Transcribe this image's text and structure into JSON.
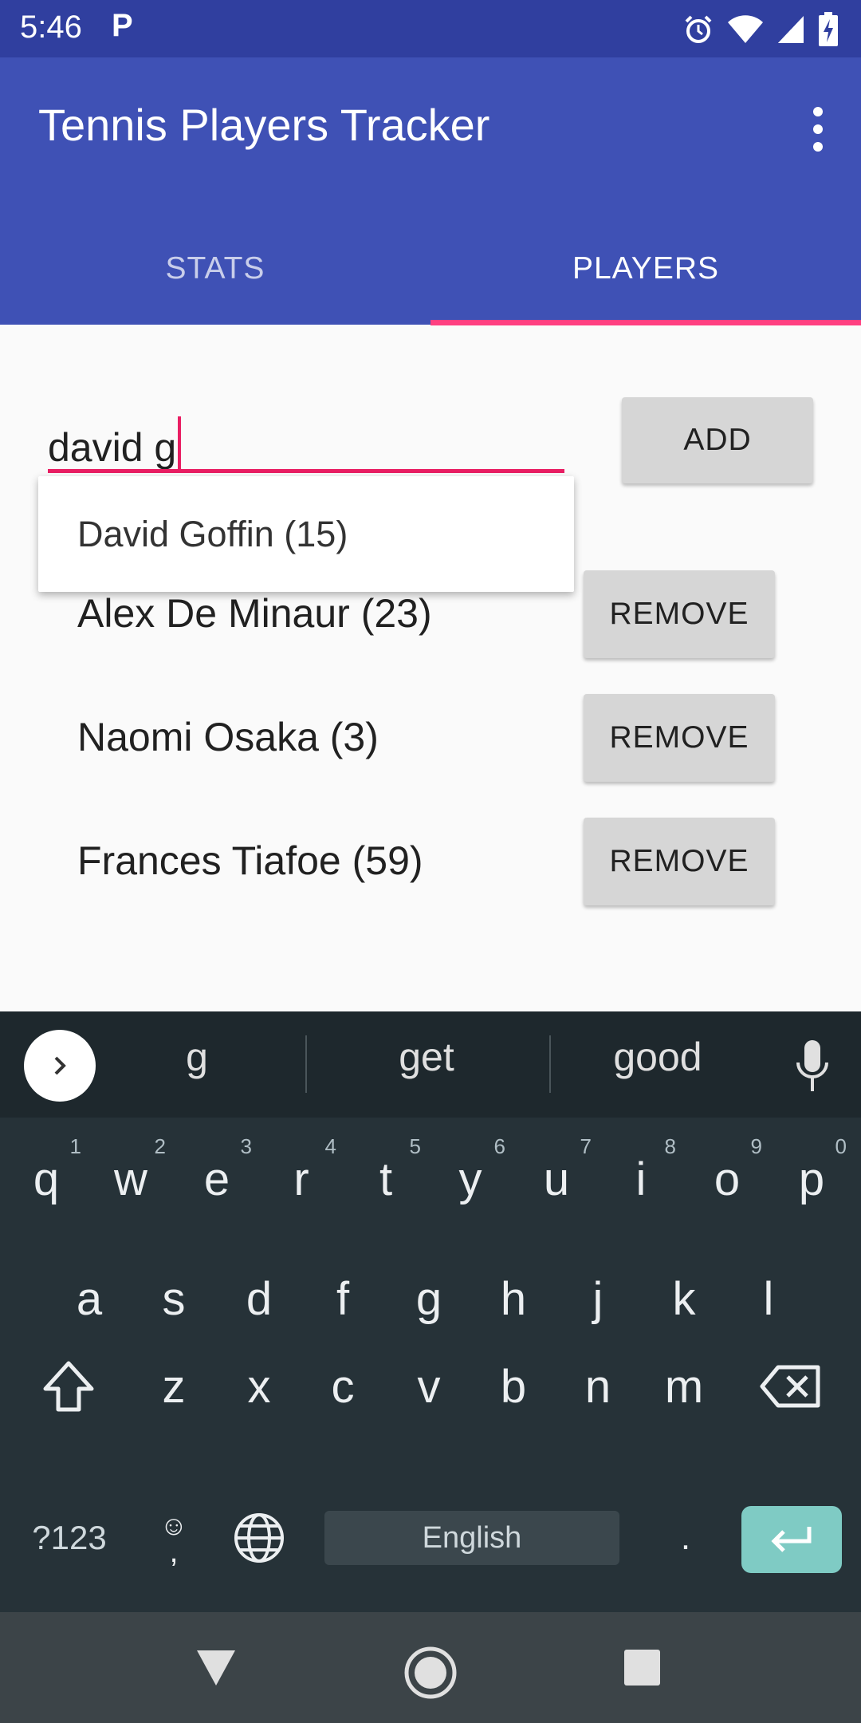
{
  "status_bar": {
    "time": "5:46",
    "notification_letter": "P"
  },
  "app_bar": {
    "title": "Tennis Players Tracker"
  },
  "tabs": [
    {
      "label": "STATS"
    },
    {
      "label": "PLAYERS"
    }
  ],
  "search": {
    "value": "david g"
  },
  "add_button": {
    "label": "ADD"
  },
  "dropdown": {
    "items": [
      {
        "label": "David Goffin (15)"
      }
    ]
  },
  "players": [
    {
      "name": "Alex De Minaur (23)",
      "action": "REMOVE"
    },
    {
      "name": "Naomi Osaka (3)",
      "action": "REMOVE"
    },
    {
      "name": "Frances Tiafoe (59)",
      "action": "REMOVE"
    }
  ],
  "keyboard": {
    "suggestions": [
      "g",
      "get",
      "good"
    ],
    "row1": [
      {
        "k": "q",
        "h": "1"
      },
      {
        "k": "w",
        "h": "2"
      },
      {
        "k": "e",
        "h": "3"
      },
      {
        "k": "r",
        "h": "4"
      },
      {
        "k": "t",
        "h": "5"
      },
      {
        "k": "y",
        "h": "6"
      },
      {
        "k": "u",
        "h": "7"
      },
      {
        "k": "i",
        "h": "8"
      },
      {
        "k": "o",
        "h": "9"
      },
      {
        "k": "p",
        "h": "0"
      }
    ],
    "row2": [
      "a",
      "s",
      "d",
      "f",
      "g",
      "h",
      "j",
      "k",
      "l"
    ],
    "row3": [
      "z",
      "x",
      "c",
      "v",
      "b",
      "n",
      "m"
    ],
    "symbols_label": "?123",
    "comma_label": ",",
    "space_label": "English",
    "period_label": "."
  }
}
